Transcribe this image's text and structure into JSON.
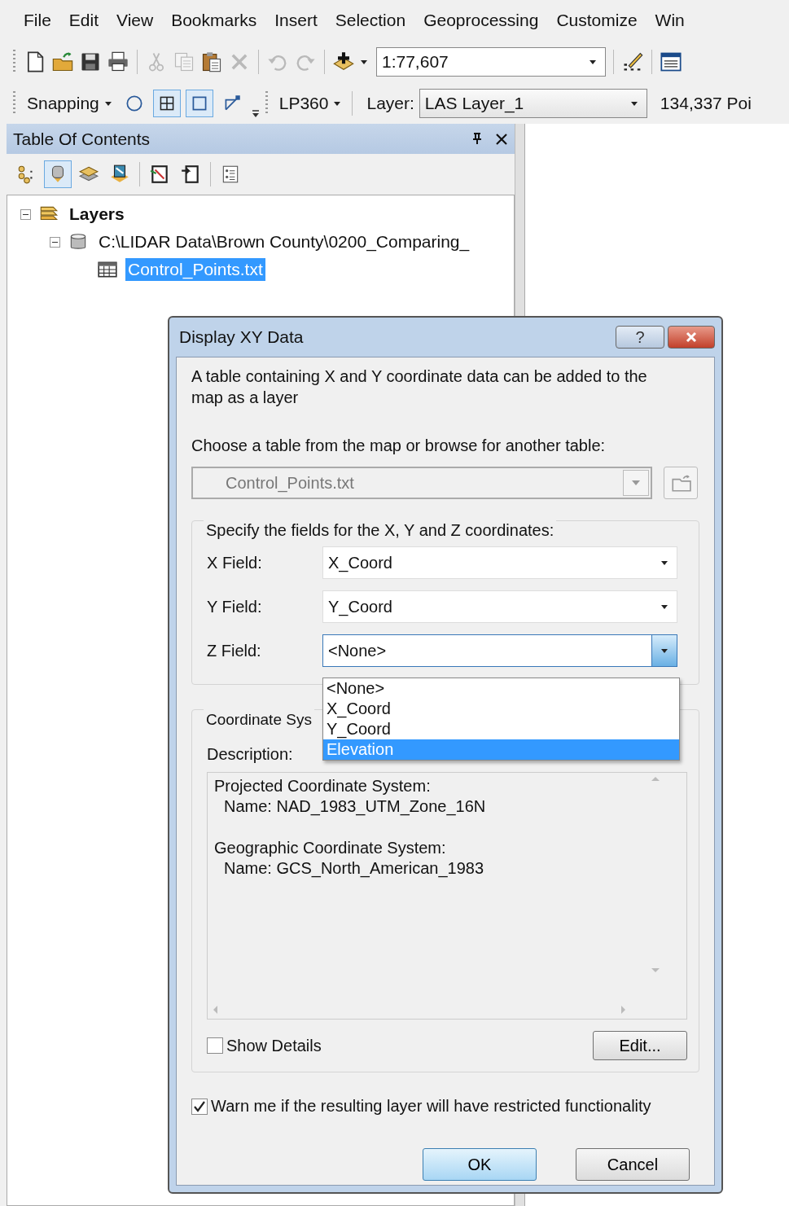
{
  "menu_bar": [
    {
      "label": "File"
    },
    {
      "label": "Edit"
    },
    {
      "label": "View"
    },
    {
      "label": "Bookmarks"
    },
    {
      "label": "Insert"
    },
    {
      "label": "Selection"
    },
    {
      "label": "Geoprocessing"
    },
    {
      "label": "Customize"
    },
    {
      "label": "Win"
    }
  ],
  "standard_toolbar": {
    "buttons": [
      {
        "kind": "new",
        "disabled": false
      },
      {
        "kind": "open",
        "disabled": false
      },
      {
        "kind": "save",
        "disabled": false
      },
      {
        "kind": "print",
        "disabled": false
      },
      {
        "kind": "cut",
        "disabled": true
      },
      {
        "kind": "copy",
        "disabled": true
      },
      {
        "kind": "paste",
        "disabled": false
      },
      {
        "kind": "delete",
        "disabled": true
      },
      {
        "kind": "undo",
        "disabled": true
      },
      {
        "kind": "redo",
        "disabled": true
      },
      {
        "kind": "add",
        "disabled": false
      }
    ],
    "scale": "1:77,607"
  },
  "snapping_toolbar": {
    "menu": "Snapping",
    "buttons": [
      {
        "kind": "point",
        "selected": false
      },
      {
        "kind": "vertex",
        "selected": true
      },
      {
        "kind": "edge",
        "selected": true
      },
      {
        "kind": "end",
        "selected": false
      }
    ],
    "lp360_menu": "LP360",
    "layer_label": "Layer:",
    "layer_value": "LAS Layer_1",
    "point_count": "134,337 Poi"
  },
  "table_of_contents": {
    "title": "Table Of Contents",
    "tools": [
      {
        "kind": "drawing_order",
        "selected": false
      },
      {
        "kind": "source",
        "selected": true
      },
      {
        "kind": "visibility",
        "selected": false
      },
      {
        "kind": "selection",
        "selected": false
      },
      {
        "kind": "add_layer",
        "selected": false
      },
      {
        "kind": "remove_layer",
        "selected": false
      },
      {
        "kind": "options",
        "selected": false
      }
    ],
    "tree": [
      {
        "kind": "frame",
        "label": "Layers",
        "expanded": true,
        "selected": false,
        "children": [
          {
            "kind": "workspace",
            "label": "C:\\LIDAR Data\\Brown County\\0200_Comparing_",
            "expanded": true,
            "selected": false,
            "children": [
              {
                "kind": "table",
                "label": "Control_Points.txt",
                "selected": true
              }
            ]
          }
        ]
      }
    ]
  },
  "dialog": {
    "title": "Display XY Data",
    "help": "?",
    "intro": "A table containing X and Y coordinate data can be added to the map as a layer",
    "choose_label": "Choose a table from the map or browse for another table:",
    "table_combo": {
      "value": "Control_Points.txt",
      "disabled": true
    },
    "fields_group": {
      "legend": "Specify the fields for the X, Y and Z coordinates:",
      "fields": [
        {
          "label": "X Field:",
          "value": "X_Coord",
          "open": false
        },
        {
          "label": "Y Field:",
          "value": "Y_Coord",
          "open": false
        },
        {
          "label": "Z Field:",
          "value": "<None>",
          "open": true
        }
      ]
    },
    "dropdown_options": [
      {
        "label": "<None>",
        "selected": false
      },
      {
        "label": "X_Coord",
        "selected": false
      },
      {
        "label": "Y_Coord",
        "selected": false
      },
      {
        "label": "Elevation",
        "selected": true
      }
    ],
    "coordinate_group": {
      "legend": "Coordinate Sys",
      "description_label": "Description:",
      "description": [
        {
          "heading": "Projected Coordinate System:",
          "name": "Name: NAD_1983_UTM_Zone_16N"
        },
        {
          "heading": "Geographic Coordinate System:",
          "name": "Name: GCS_North_American_1983"
        }
      ],
      "show_details": {
        "label": "Show Details",
        "checked": false
      },
      "edit_button": "Edit..."
    },
    "warn": {
      "label": "Warn me if the resulting layer will have restricted functionality",
      "checked": true
    },
    "buttons": [
      {
        "label": "OK",
        "default": true
      },
      {
        "label": "Cancel",
        "default": false
      }
    ]
  }
}
